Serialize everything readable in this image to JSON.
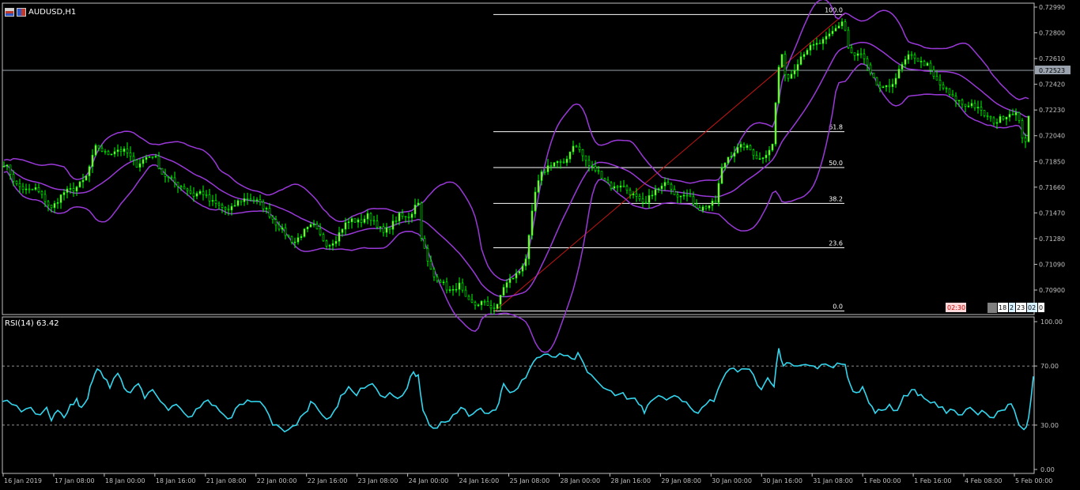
{
  "header": {
    "symbol": "AUDUSD,H1",
    "icon1": "chart-properties-icon",
    "icon2": "symbol-flag-icon"
  },
  "colors": {
    "background": "#000000",
    "axis": "#c0c0c0",
    "candle_up": "#00ff00",
    "candle_body": "#a6e85d",
    "bollinger": "#9a39d8",
    "fibo_levels": "#ffffff",
    "fibo_trend": "#c81414",
    "rsi_line": "#33d6ee",
    "bid_line": "#9aa3ad"
  },
  "chart_data": [
    {
      "type": "candlestick",
      "title": "AUDUSD,H1",
      "y_ticks": [
        "0.72990",
        "0.72800",
        "0.72610",
        "0.72420",
        "0.72230",
        "0.72040",
        "0.71850",
        "0.71660",
        "0.71470",
        "0.71280",
        "0.71090",
        "0.70900"
      ],
      "ylim": [
        0.7071,
        0.7302
      ],
      "current_price": "0.72523",
      "x_ticks": [
        "16 Jan 2019",
        "17 Jan 08:00",
        "18 Jan 00:00",
        "18 Jan 16:00",
        "21 Jan 08:00",
        "22 Jan 00:00",
        "22 Jan 16:00",
        "23 Jan 08:00",
        "24 Jan 00:00",
        "24 Jan 16:00",
        "25 Jan 08:00",
        "28 Jan 00:00",
        "28 Jan 16:00",
        "29 Jan 08:00",
        "30 Jan 00:00",
        "30 Jan 16:00",
        "31 Jan 08:00",
        "1 Feb 00:00",
        "1 Feb 16:00",
        "4 Feb 08:00",
        "5 Feb 00:00"
      ],
      "close_path": [
        [
          0,
          0.7187
        ],
        [
          10,
          0.718
        ],
        [
          20,
          0.7168
        ],
        [
          35,
          0.7163
        ],
        [
          45,
          0.7165
        ],
        [
          55,
          0.7158
        ],
        [
          65,
          0.715
        ],
        [
          80,
          0.7162
        ],
        [
          95,
          0.7165
        ],
        [
          108,
          0.7172
        ],
        [
          122,
          0.7197
        ],
        [
          135,
          0.719
        ],
        [
          148,
          0.7194
        ],
        [
          160,
          0.7192
        ],
        [
          172,
          0.7182
        ],
        [
          185,
          0.7188
        ],
        [
          195,
          0.719
        ],
        [
          205,
          0.7176
        ],
        [
          215,
          0.7172
        ],
        [
          225,
          0.7168
        ],
        [
          235,
          0.7165
        ],
        [
          245,
          0.716
        ],
        [
          255,
          0.7163
        ],
        [
          265,
          0.7156
        ],
        [
          278,
          0.7152
        ],
        [
          290,
          0.7148
        ],
        [
          300,
          0.7155
        ],
        [
          312,
          0.7158
        ],
        [
          324,
          0.7156
        ],
        [
          336,
          0.715
        ],
        [
          348,
          0.714
        ],
        [
          360,
          0.7132
        ],
        [
          372,
          0.7125
        ],
        [
          384,
          0.7133
        ],
        [
          396,
          0.7138
        ],
        [
          405,
          0.713
        ],
        [
          415,
          0.7123
        ],
        [
          425,
          0.7128
        ],
        [
          435,
          0.7138
        ],
        [
          445,
          0.7142
        ],
        [
          455,
          0.714
        ],
        [
          465,
          0.7145
        ],
        [
          475,
          0.714
        ],
        [
          485,
          0.7132
        ],
        [
          495,
          0.7138
        ],
        [
          505,
          0.7145
        ],
        [
          515,
          0.7143
        ],
        [
          522,
          0.7148
        ],
        [
          528,
          0.716
        ],
        [
          533,
          0.713
        ],
        [
          540,
          0.7112
        ],
        [
          548,
          0.71
        ],
        [
          556,
          0.7098
        ],
        [
          564,
          0.7092
        ],
        [
          572,
          0.7088
        ],
        [
          580,
          0.7095
        ],
        [
          590,
          0.7082
        ],
        [
          600,
          0.7079
        ],
        [
          610,
          0.7081
        ],
        [
          620,
          0.7078
        ],
        [
          628,
          0.7076
        ],
        [
          636,
          0.7092
        ],
        [
          646,
          0.7098
        ],
        [
          656,
          0.7103
        ],
        [
          666,
          0.7115
        ],
        [
          676,
          0.716
        ],
        [
          684,
          0.7175
        ],
        [
          694,
          0.7182
        ],
        [
          704,
          0.7185
        ],
        [
          714,
          0.7182
        ],
        [
          722,
          0.7195
        ],
        [
          728,
          0.7198
        ],
        [
          736,
          0.719
        ],
        [
          745,
          0.7182
        ],
        [
          755,
          0.7178
        ],
        [
          765,
          0.7172
        ],
        [
          775,
          0.7165
        ],
        [
          785,
          0.7168
        ],
        [
          795,
          0.7163
        ],
        [
          805,
          0.7158
        ],
        [
          815,
          0.7152
        ],
        [
          825,
          0.7162
        ],
        [
          835,
          0.7165
        ],
        [
          845,
          0.717
        ],
        [
          855,
          0.716
        ],
        [
          865,
          0.7162
        ],
        [
          875,
          0.7156
        ],
        [
          885,
          0.715
        ],
        [
          895,
          0.7152
        ],
        [
          905,
          0.7155
        ],
        [
          912,
          0.7178
        ],
        [
          920,
          0.7188
        ],
        [
          930,
          0.7193
        ],
        [
          940,
          0.7197
        ],
        [
          950,
          0.7193
        ],
        [
          960,
          0.7186
        ],
        [
          970,
          0.7192
        ],
        [
          978,
          0.7198
        ],
        [
          983,
          0.7248
        ],
        [
          988,
          0.7265
        ],
        [
          995,
          0.7245
        ],
        [
          1003,
          0.7252
        ],
        [
          1012,
          0.7262
        ],
        [
          1020,
          0.7268
        ],
        [
          1028,
          0.727
        ],
        [
          1036,
          0.7272
        ],
        [
          1044,
          0.7275
        ],
        [
          1052,
          0.728
        ],
        [
          1060,
          0.7285
        ],
        [
          1067,
          0.729
        ],
        [
          1072,
          0.727
        ],
        [
          1080,
          0.7262
        ],
        [
          1088,
          0.7265
        ],
        [
          1095,
          0.7258
        ],
        [
          1100,
          0.725
        ],
        [
          1108,
          0.7242
        ],
        [
          1116,
          0.7238
        ],
        [
          1124,
          0.724
        ],
        [
          1132,
          0.7246
        ],
        [
          1140,
          0.7255
        ],
        [
          1148,
          0.7262
        ],
        [
          1156,
          0.7263
        ],
        [
          1164,
          0.7258
        ],
        [
          1172,
          0.7257
        ],
        [
          1180,
          0.7248
        ],
        [
          1188,
          0.7242
        ],
        [
          1196,
          0.7238
        ],
        [
          1204,
          0.7232
        ],
        [
          1212,
          0.723
        ],
        [
          1220,
          0.7226
        ],
        [
          1228,
          0.7228
        ],
        [
          1236,
          0.7224
        ],
        [
          1244,
          0.722
        ],
        [
          1252,
          0.7216
        ],
        [
          1260,
          0.7214
        ],
        [
          1268,
          0.7218
        ],
        [
          1276,
          0.722
        ],
        [
          1284,
          0.7222
        ],
        [
          1290,
          0.7212
        ],
        [
          1295,
          0.7198
        ],
        [
          1300,
          0.7205
        ],
        [
          1304,
          0.7252
        ]
      ],
      "indicator": "Bollinger Bands",
      "fibonacci": {
        "levels": [
          {
            "label": "100.0",
            "price": 0.72935
          },
          {
            "label": "61.8",
            "price": 0.7207
          },
          {
            "label": "50.0",
            "price": 0.71805
          },
          {
            "label": "38.2",
            "price": 0.7154
          },
          {
            "label": "23.6",
            "price": 0.71212
          },
          {
            "label": "0.0",
            "price": 0.70745
          }
        ],
        "trend_from": [
          626,
          0.70745
        ],
        "trend_to": [
          1067,
          0.72935
        ]
      },
      "status_labels": [
        "02:30",
        "18",
        "2",
        "23",
        "02",
        "0"
      ]
    },
    {
      "type": "line",
      "title": "RSI(14) 63.42",
      "ylim": [
        0,
        100
      ],
      "y_ticks": [
        "100.00",
        "70.00",
        "30.00",
        "0.00"
      ],
      "levels": [
        70,
        30
      ],
      "series": [
        {
          "values": [
            [
              0,
              46
            ],
            [
              12,
              44
            ],
            [
              24,
              39
            ],
            [
              36,
              42
            ],
            [
              48,
              37
            ],
            [
              56,
              42
            ],
            [
              62,
              33
            ],
            [
              70,
              40
            ],
            [
              78,
              35
            ],
            [
              86,
              44
            ],
            [
              94,
              48
            ],
            [
              100,
              42
            ],
            [
              108,
              48
            ],
            [
              114,
              60
            ],
            [
              120,
              68
            ],
            [
              128,
              62
            ],
            [
              136,
              55
            ],
            [
              146,
              65
            ],
            [
              154,
              55
            ],
            [
              162,
              52
            ],
            [
              172,
              58
            ],
            [
              180,
              48
            ],
            [
              190,
              54
            ],
            [
              200,
              46
            ],
            [
              210,
              40
            ],
            [
              220,
              44
            ],
            [
              230,
              38
            ],
            [
              240,
              36
            ],
            [
              250,
              42
            ],
            [
              260,
              47
            ],
            [
              270,
              43
            ],
            [
              280,
              37
            ],
            [
              290,
              35
            ],
            [
              300,
              44
            ],
            [
              310,
              47
            ],
            [
              320,
              46
            ],
            [
              332,
              42
            ],
            [
              342,
              30
            ],
            [
              352,
              28
            ],
            [
              362,
              27
            ],
            [
              372,
              30
            ],
            [
              382,
              38
            ],
            [
              390,
              46
            ],
            [
              400,
              40
            ],
            [
              410,
              34
            ],
            [
              420,
              40
            ],
            [
              428,
              50
            ],
            [
              438,
              56
            ],
            [
              448,
              50
            ],
            [
              458,
              55
            ],
            [
              468,
              58
            ],
            [
              478,
              50
            ],
            [
              490,
              52
            ],
            [
              500,
              48
            ],
            [
              512,
              55
            ],
            [
              520,
              66
            ],
            [
              526,
              64
            ],
            [
              532,
              40
            ],
            [
              540,
              30
            ],
            [
              550,
              28
            ],
            [
              560,
              32
            ],
            [
              570,
              37
            ],
            [
              580,
              42
            ],
            [
              590,
              36
            ],
            [
              600,
              40
            ],
            [
              610,
              38
            ],
            [
              620,
              40
            ],
            [
              628,
              45
            ],
            [
              634,
              58
            ],
            [
              642,
              52
            ],
            [
              652,
              55
            ],
            [
              662,
              62
            ],
            [
              672,
              73
            ],
            [
              680,
              76
            ],
            [
              690,
              78
            ],
            [
              700,
              76
            ],
            [
              710,
              77
            ],
            [
              720,
              75
            ],
            [
              728,
              79
            ],
            [
              735,
              72
            ],
            [
              745,
              64
            ],
            [
              755,
              58
            ],
            [
              765,
              54
            ],
            [
              775,
              50
            ],
            [
              785,
              52
            ],
            [
              795,
              48
            ],
            [
              805,
              44
            ],
            [
              812,
              38
            ],
            [
              820,
              46
            ],
            [
              830,
              50
            ],
            [
              840,
              47
            ],
            [
              850,
              50
            ],
            [
              860,
              46
            ],
            [
              870,
              42
            ],
            [
              880,
              38
            ],
            [
              890,
              44
            ],
            [
              900,
              46
            ],
            [
              910,
              60
            ],
            [
              920,
              68
            ],
            [
              930,
              66
            ],
            [
              940,
              68
            ],
            [
              950,
              64
            ],
            [
              960,
              54
            ],
            [
              968,
              62
            ],
            [
              976,
              56
            ],
            [
              982,
              82
            ],
            [
              988,
              70
            ],
            [
              996,
              72
            ],
            [
              1006,
              70
            ],
            [
              1016,
              71
            ],
            [
              1026,
              70
            ],
            [
              1036,
              71
            ],
            [
              1046,
              70
            ],
            [
              1056,
              72
            ],
            [
              1066,
              71
            ],
            [
              1072,
              58
            ],
            [
              1080,
              52
            ],
            [
              1088,
              56
            ],
            [
              1096,
              45
            ],
            [
              1104,
              38
            ],
            [
              1112,
              40
            ],
            [
              1122,
              44
            ],
            [
              1132,
              40
            ],
            [
              1140,
              50
            ],
            [
              1150,
              54
            ],
            [
              1158,
              50
            ],
            [
              1166,
              48
            ],
            [
              1174,
              45
            ],
            [
              1184,
              42
            ],
            [
              1194,
              38
            ],
            [
              1204,
              40
            ],
            [
              1214,
              37
            ],
            [
              1224,
              42
            ],
            [
              1234,
              37
            ],
            [
              1244,
              38
            ],
            [
              1254,
              35
            ],
            [
              1264,
              40
            ],
            [
              1272,
              44
            ],
            [
              1280,
              40
            ],
            [
              1286,
              30
            ],
            [
              1292,
              27
            ],
            [
              1298,
              35
            ],
            [
              1304,
              63
            ]
          ]
        }
      ]
    }
  ]
}
